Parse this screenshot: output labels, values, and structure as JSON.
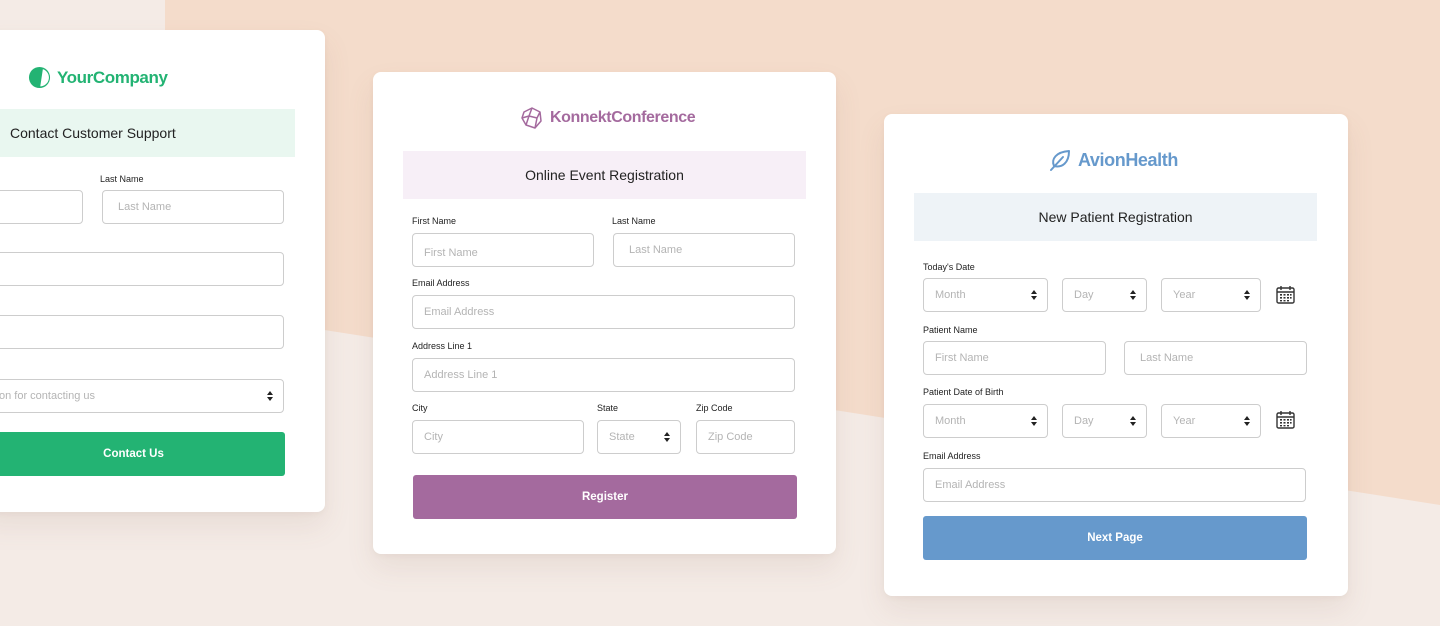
{
  "colors": {
    "yourcompany_green": "#23b373",
    "yourcompany_band": "#e9f7f0",
    "konnekt_purple": "#a46a9e",
    "konnekt_band": "#f7eff7",
    "avion_blue": "#6699cc",
    "avion_band": "#eef3f7"
  },
  "cards": {
    "yourcompany": {
      "logo_text": "YourCompany",
      "logo_icon": "half-circle-icon",
      "title": "Contact Customer Support",
      "fields": {
        "last_name_label": "Last Name",
        "last_name_placeholder": "Last Name",
        "reason_placeholder": "on for contacting us"
      },
      "submit_label": "Contact Us"
    },
    "konnekt": {
      "logo_text": "KonnektConference",
      "logo_icon": "polyhedron-icon",
      "title": "Online Event Registration",
      "fields": {
        "first_name_label": "First Name",
        "first_name_placeholder": "First Name",
        "last_name_label": "Last Name",
        "last_name_placeholder": "Last Name",
        "email_label": "Email Address",
        "email_placeholder": "Email Address",
        "address_label": "Address Line 1",
        "address_placeholder": "Address Line 1",
        "city_label": "City",
        "city_placeholder": "City",
        "state_label": "State",
        "state_placeholder": "State",
        "zip_label": "Zip Code",
        "zip_placeholder": "Zip Code"
      },
      "submit_label": "Register"
    },
    "avion": {
      "logo_text": "AvionHealth",
      "logo_icon": "leaf-icon",
      "title": "New Patient Registration",
      "fields": {
        "todays_date_label": "Today's Date",
        "month_placeholder": "Month",
        "day_placeholder": "Day",
        "year_placeholder": "Year",
        "patient_name_label": "Patient Name",
        "first_name_placeholder": "First Name",
        "last_name_placeholder": "Last Name",
        "dob_label": "Patient Date of Birth",
        "email_label": "Email Address",
        "email_placeholder": "Email Address"
      },
      "submit_label": "Next Page"
    }
  }
}
